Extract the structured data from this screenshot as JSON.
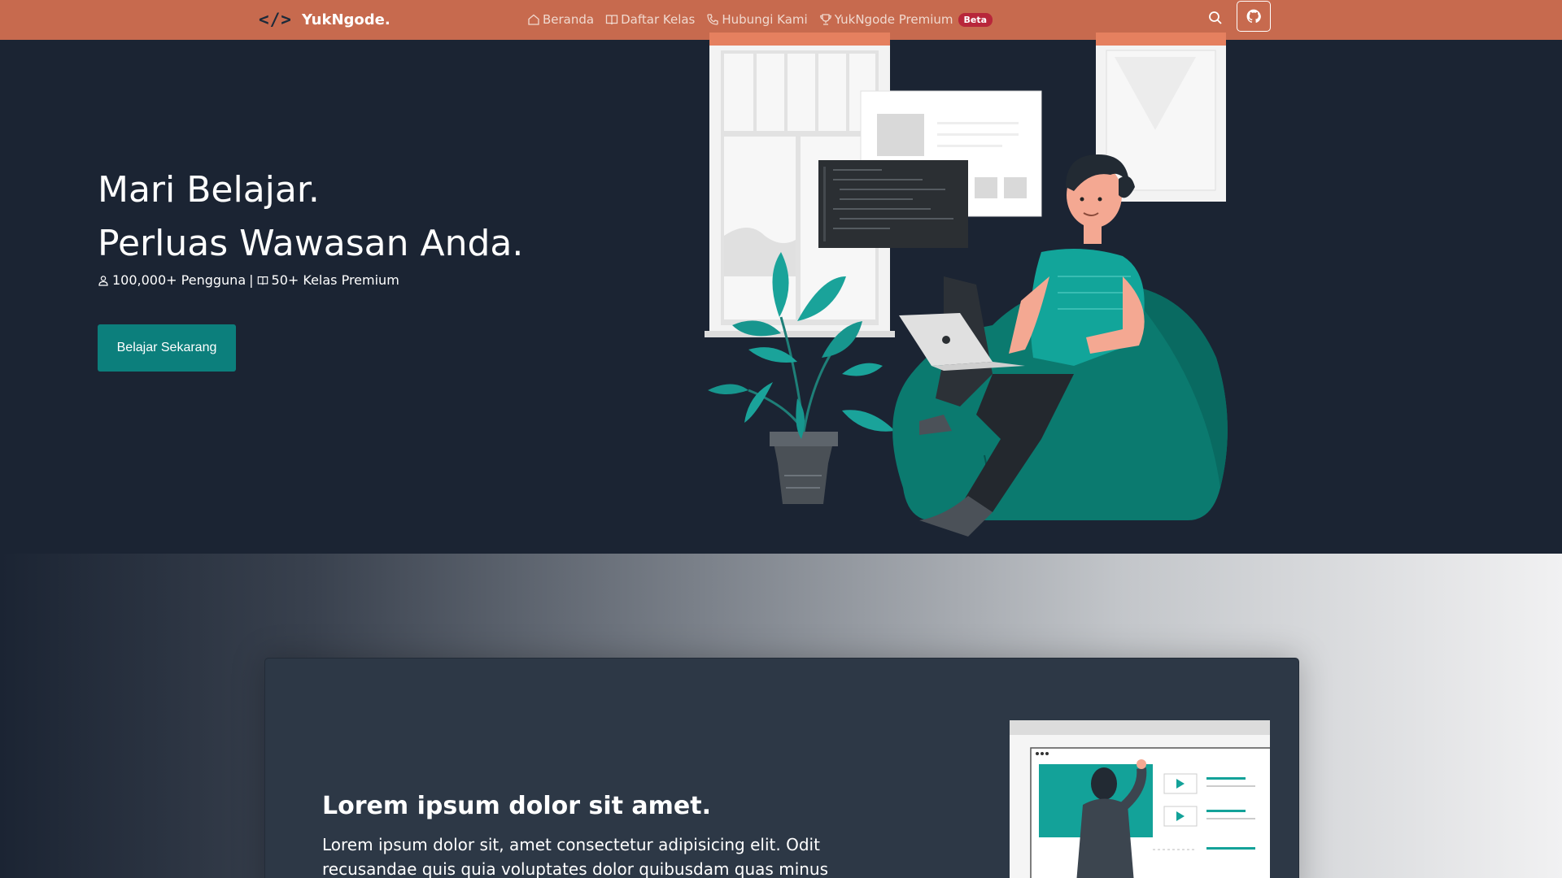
{
  "navbar": {
    "brand_icon": "</>",
    "brand_name": "YukNgode.",
    "links": [
      {
        "label": "Beranda",
        "icon": "home-icon"
      },
      {
        "label": "Daftar Kelas",
        "icon": "book-icon"
      },
      {
        "label": "Hubungi Kami",
        "icon": "phone-icon"
      },
      {
        "label": "YukNgode Premium",
        "icon": "trophy-icon"
      }
    ],
    "badge": "Beta",
    "search_icon": "search-icon",
    "github_icon": "github-icon"
  },
  "hero": {
    "title_line1": "Mari Belajar.",
    "title_line2": "Perluas Wawasan Anda.",
    "stat_users": "100,000+ Pengguna",
    "stat_separator": "|",
    "stat_classes": "50+ Kelas Premium",
    "cta_label": "Belajar Sekarang"
  },
  "feature": {
    "title": "Lorem ipsum dolor sit amet.",
    "body": "Lorem ipsum dolor sit, amet consectetur adipisicing elit. Odit recusandae quis quia voluptates dolor quibusdam quas minus"
  },
  "colors": {
    "navbar": "#c76a4e",
    "hero_bg": "#1b2433",
    "accent_teal": "#0c7f7c",
    "badge": "#b8263a"
  }
}
